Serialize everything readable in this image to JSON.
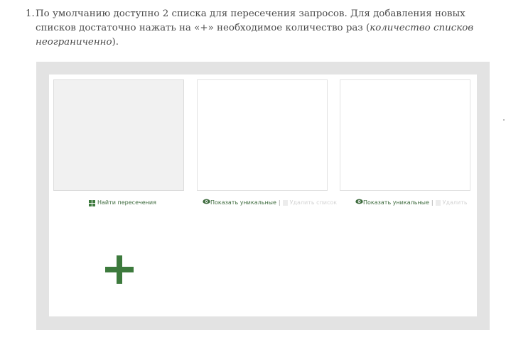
{
  "instruction": {
    "number": "1.",
    "text_before": "По умолчанию доступно 2 списка для пересечения запросов. Для добавления новых списков достаточно нажать на «+» необходимое количество раз (",
    "text_italic": "количество списков неограниченно",
    "text_after": ")."
  },
  "lists": [
    {
      "action_label": "Найти пересечения",
      "icon": "grid-icon"
    },
    {
      "action_label": "Показать уникальные",
      "separator": "|",
      "delete_label": "Удалить список",
      "icon": "eye-icon"
    },
    {
      "action_label": "Показать уникальные",
      "separator": "|",
      "delete_label": "Удалить",
      "icon": "eye-icon"
    }
  ],
  "add_button": {
    "icon": "plus-icon"
  },
  "colors": {
    "accent": "#3d7a3d",
    "frame": "#e3e3e3",
    "list_grey": "#f1f1f1"
  }
}
